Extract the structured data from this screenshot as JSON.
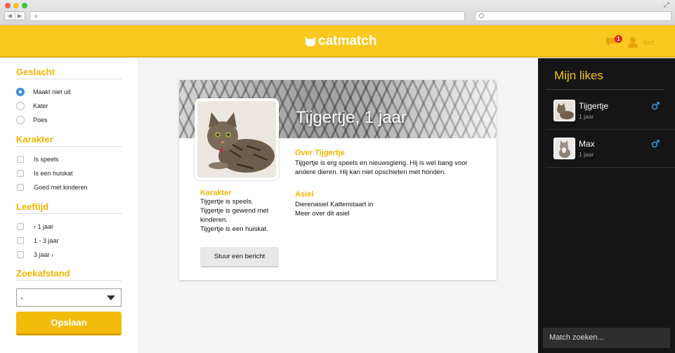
{
  "header": {
    "brand": "catmatch",
    "notification_count": "1",
    "username": "ted"
  },
  "filters": {
    "gender": {
      "title": "Geslacht",
      "options": [
        "Maakt niet uit",
        "Kater",
        "Poes"
      ],
      "selected": "Maakt niet uit"
    },
    "character": {
      "title": "Karakter",
      "options": [
        "Is speels",
        "Is een huiskat",
        "Goed met kinderen"
      ]
    },
    "age": {
      "title": "Leeftijd",
      "options": [
        "‹ 1 jaar",
        "1 - 3 jaar",
        "3 jaar ›"
      ]
    },
    "distance": {
      "title": "Zoekafstand",
      "value": "-"
    },
    "save_label": "Opslaan"
  },
  "profile": {
    "title": "Tijgertje, 1 jaar",
    "about_title": "Over Tijgertje",
    "about_text": "Tijgertje is erg speels en nieuwsgierig. Hij is wel bang voor andere dieren. Hij kan niet opschieten met honden.",
    "shelter_title": "Asiel",
    "shelter_name": "Dierenasiel Kattenstaart in",
    "shelter_link": "Meer over dit asiel",
    "character_title": "Karakter",
    "character_lines": [
      "Tijgertje is speels.",
      "Tijgertje is gewend met kinderen.",
      "Tijgertje is een huiskat."
    ],
    "message_label": "Stuur een bericht"
  },
  "likes": {
    "title": "Mijn likes",
    "items": [
      {
        "name": "Tijgertje",
        "age": "1 jaar",
        "gender_icon": "male-icon"
      },
      {
        "name": "Max",
        "age": "1 jaar",
        "gender_icon": "male-icon"
      }
    ],
    "search_placeholder": "Match zoeken..."
  },
  "colors": {
    "brand_yellow": "#fbc81f",
    "accent_text": "#f4b400",
    "dark_panel": "#151515",
    "male_blue": "#3a9be0"
  }
}
